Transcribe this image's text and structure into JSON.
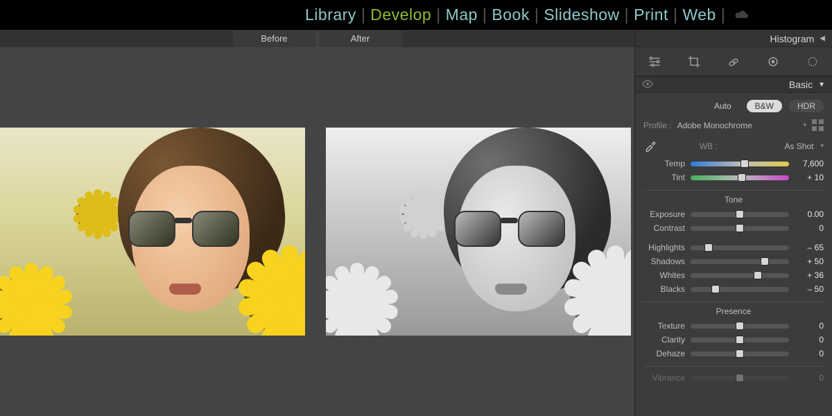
{
  "modules": {
    "items": [
      "Library",
      "Develop",
      "Map",
      "Book",
      "Slideshow",
      "Print",
      "Web"
    ],
    "active": "Develop"
  },
  "compare": {
    "before_label": "Before",
    "after_label": "After"
  },
  "rpanel": {
    "histogram_title": "Histogram",
    "tools": {
      "edit": "edit-settings-icon",
      "crop": "crop-icon",
      "heal": "healing-icon",
      "mask": "masking-icon",
      "redeye": "redeye-icon"
    },
    "basic": {
      "title": "Basic",
      "treatment": {
        "auto_label": "Auto",
        "bw_label": "B&W",
        "hdr_label": "HDR",
        "selected": "B&W"
      },
      "profile": {
        "label": "Profile :",
        "value": "Adobe Monochrome"
      },
      "wb": {
        "label": "WB :",
        "value": "As Shot",
        "temp": {
          "label": "Temp",
          "value": "7,600",
          "pos": 55
        },
        "tint": {
          "label": "Tint",
          "value": "+ 10",
          "pos": 52
        }
      },
      "tone": {
        "title": "Tone",
        "exposure": {
          "label": "Exposure",
          "value": "0.00",
          "pos": 50
        },
        "contrast": {
          "label": "Contrast",
          "value": "0",
          "pos": 50
        },
        "highlights": {
          "label": "Highlights",
          "value": "– 65",
          "pos": 18
        },
        "shadows": {
          "label": "Shadows",
          "value": "+ 50",
          "pos": 75
        },
        "whites": {
          "label": "Whites",
          "value": "+ 36",
          "pos": 68
        },
        "blacks": {
          "label": "Blacks",
          "value": "– 50",
          "pos": 25
        }
      },
      "presence": {
        "title": "Presence",
        "texture": {
          "label": "Texture",
          "value": "0",
          "pos": 50
        },
        "clarity": {
          "label": "Clarity",
          "value": "0",
          "pos": 50
        },
        "dehaze": {
          "label": "Dehaze",
          "value": "0",
          "pos": 50
        }
      },
      "vibrance_cut": {
        "label": "Vibrance",
        "value": "0",
        "pos": 50
      }
    }
  }
}
